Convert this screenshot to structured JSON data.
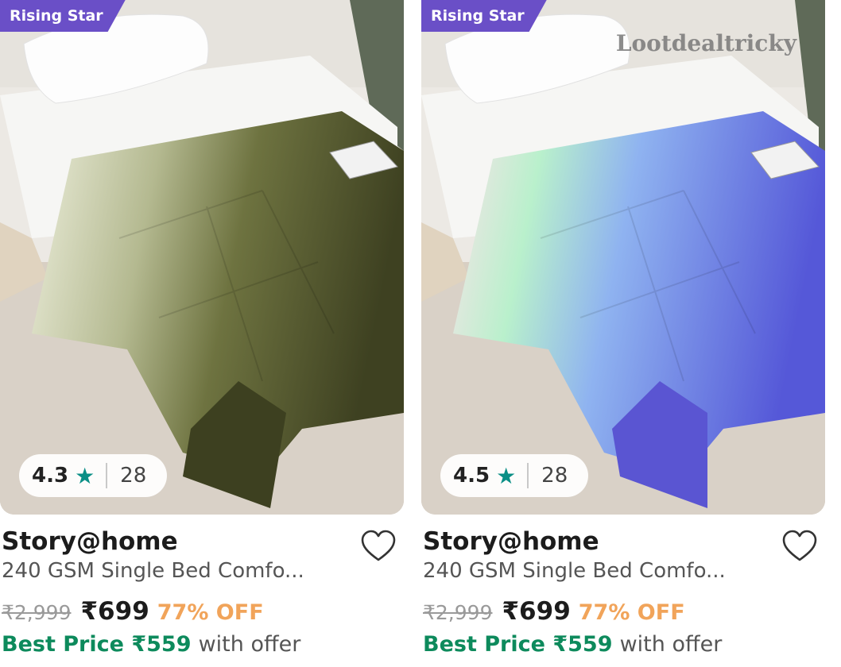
{
  "products": [
    {
      "badge": "Rising Star",
      "rating": "4.3",
      "rating_count": "28",
      "brand": "Story@home",
      "title": "240 GSM Single Bed Comfo...",
      "mrp": "₹2,999",
      "price": "₹699",
      "discount": "77% OFF",
      "best_price_label": "Best Price ₹559",
      "best_price_suffix": "with offer",
      "colors": {
        "light": "#e9ecd8",
        "dark": "#4a4d2a"
      }
    },
    {
      "badge": "Rising Star",
      "rating": "4.5",
      "rating_count": "28",
      "brand": "Story@home",
      "title": "240 GSM Single Bed Comfo...",
      "mrp": "₹2,999",
      "price": "₹699",
      "discount": "77% OFF",
      "best_price_label": "Best Price ₹559",
      "best_price_suffix": "with offer",
      "watermark": "Lootdealtricky",
      "colors": {
        "light": "#f8dfe6",
        "mid": "#b8f0c8",
        "dark": "#5a5fd6"
      }
    }
  ],
  "icons": {
    "star": "star-icon",
    "heart": "heart-outline-icon"
  },
  "theme": {
    "badge_bg": "#6a4fc7",
    "star_color": "#0a8f86",
    "discount_color": "#f1a45a",
    "best_price_color": "#0d8a5c"
  }
}
